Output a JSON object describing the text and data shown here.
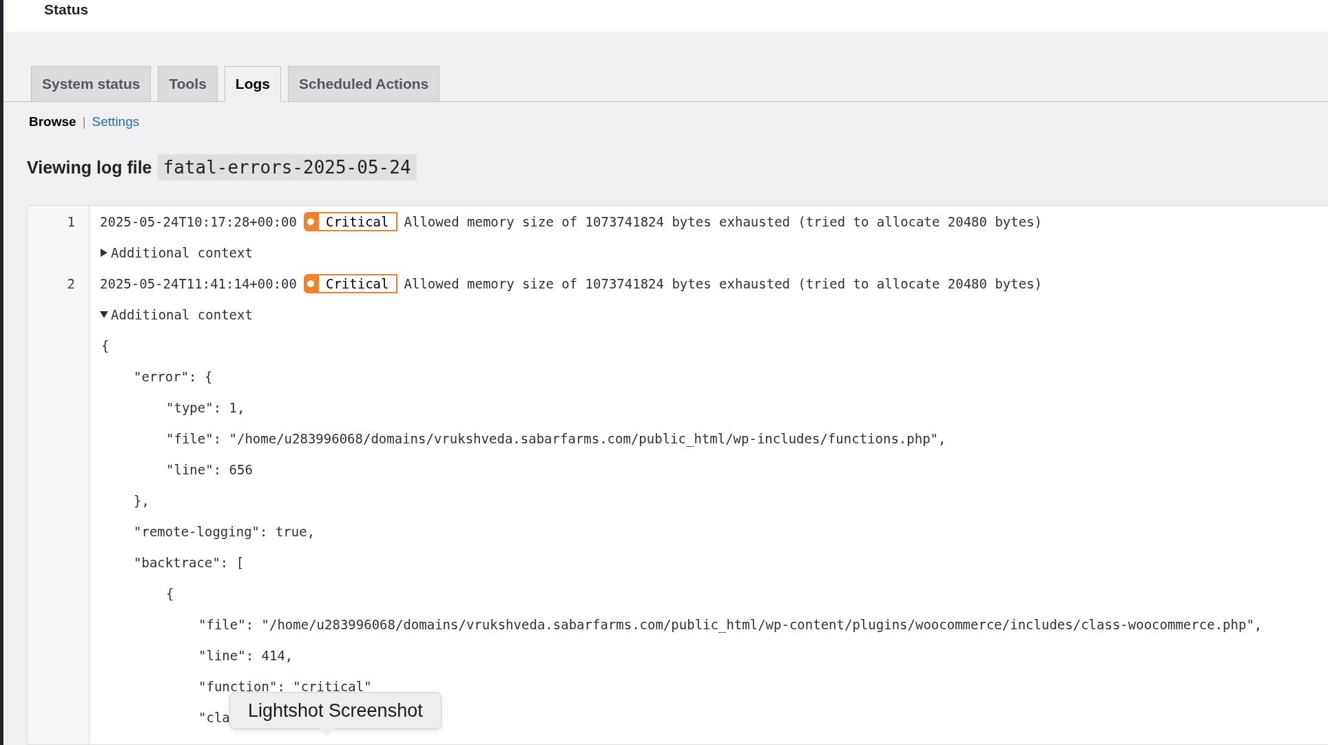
{
  "header": {
    "title": "Status"
  },
  "tabs": [
    {
      "label": "System status",
      "selected": false
    },
    {
      "label": "Tools",
      "selected": false
    },
    {
      "label": "Logs",
      "selected": true
    },
    {
      "label": "Scheduled Actions",
      "selected": false
    }
  ],
  "subnav": [
    {
      "label": "Browse",
      "selected": true
    },
    {
      "label": "Settings",
      "selected": false
    }
  ],
  "subnav_separator": "|",
  "heading": {
    "label": "Viewing log file",
    "file": "fatal-errors-2025-05-24"
  },
  "log": {
    "entries": [
      {
        "line": "1",
        "timestamp": "2025-05-24T10:17:28+00:00",
        "level": "Critical",
        "message": "Allowed memory size of 1073741824 bytes exhausted (tried to allocate 20480 bytes)",
        "context": {
          "label": "Additional context",
          "expanded": false
        }
      },
      {
        "line": "2",
        "timestamp": "2025-05-24T11:41:14+00:00",
        "level": "Critical",
        "message": "Allowed memory size of 1073741824 bytes exhausted (tried to allocate 20480 bytes)",
        "context": {
          "label": "Additional context",
          "expanded": true,
          "lines": [
            {
              "text": "{",
              "children": [
                {
                  "text": "\"error\": {",
                  "children": [
                    {
                      "text": "\"type\": 1,"
                    },
                    {
                      "text": "\"file\": \"/home/u283996068/domains/vrukshveda.sabarfarms.com/public_html/wp-includes/functions.php\","
                    },
                    {
                      "text": "\"line\": 656"
                    }
                  ]
                },
                {
                  "text": "},"
                },
                {
                  "text": "\"remote-logging\": true,"
                },
                {
                  "text": "\"backtrace\": [",
                  "children": [
                    {
                      "text": "{",
                      "children": [
                        {
                          "text": "\"file\": \"/home/u283996068/domains/vrukshveda.sabarfarms.com/public_html/wp-content/plugins/woocommerce/includes/class-woocommerce.php\","
                        },
                        {
                          "text": "\"line\": 414,"
                        },
                        {
                          "text": "\"function\": \"critical\""
                        },
                        {
                          "text": "\"cla"
                        }
                      ]
                    }
                  ]
                }
              ]
            }
          ]
        }
      }
    ]
  },
  "tooltip": {
    "text": "Lightshot Screenshot"
  }
}
